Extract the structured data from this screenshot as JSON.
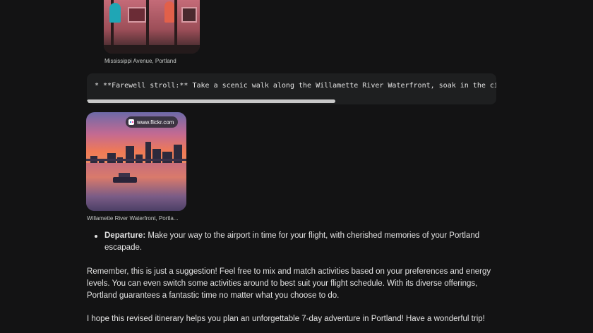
{
  "images": {
    "top": {
      "caption": "Mississippi Avenue, Portland"
    },
    "bottom": {
      "caption": "Willamette River Waterfront, Portla...",
      "source": "www.flickr.com"
    }
  },
  "code_block": {
    "line": "* **Farewell stroll:** Take a scenic walk along the Willamette River Waterfront, soak in the city",
    "scroll_position": 0.6
  },
  "bullets": [
    {
      "label": "Departure:",
      "text": "Make your way to the airport in time for your flight, with cherished memories of your Portland escapade."
    }
  ],
  "paragraphs": [
    "Remember, this is just a suggestion! Feel free to mix and match activities based on your preferences and energy levels. You can even switch some activities around to best suit your flight schedule. With its diverse offerings, Portland guarantees a fantastic time no matter what you choose to do.",
    "I hope this revised itinerary helps you plan an unforgettable 7-day adventure in Portland! Have a wonderful trip!"
  ],
  "colors": {
    "background": "#131314",
    "code_background": "#1e1f20",
    "text": "#e3e3e3",
    "caption": "#c4c7c5"
  }
}
